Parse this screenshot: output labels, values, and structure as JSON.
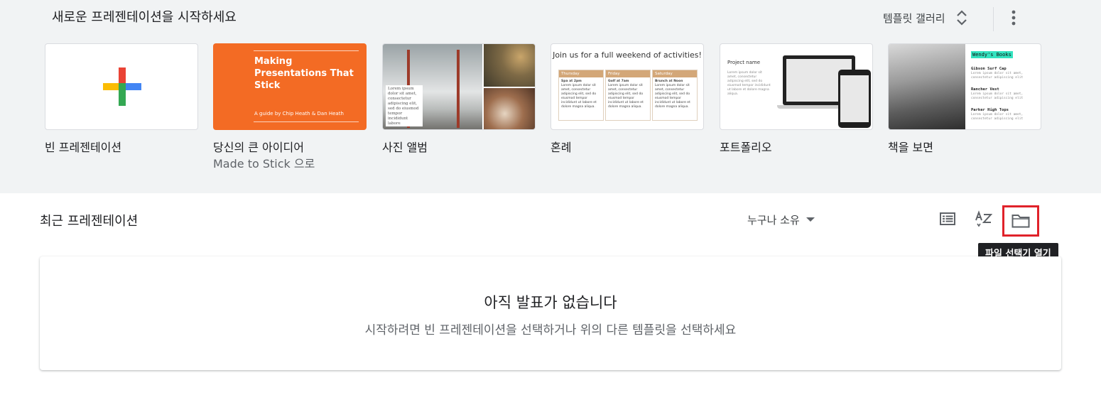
{
  "gallery": {
    "title": "새로운 프레젠테이션을 시작하세요",
    "template_gallery_label": "템플릿 갤러리",
    "templates": [
      {
        "label": "빈 프레젠테이션",
        "sublabel": ""
      },
      {
        "label": "당신의 큰 아이디어",
        "sublabel": "Made to Stick 으로"
      },
      {
        "label": "사진 앨범",
        "sublabel": ""
      },
      {
        "label": "혼례",
        "sublabel": ""
      },
      {
        "label": "포트폴리오",
        "sublabel": ""
      },
      {
        "label": "책을 보면",
        "sublabel": ""
      }
    ],
    "thumbs": {
      "made_to_stick_title": "Making Presentations That Stick",
      "made_to_stick_sub": "A guide by Chip Heath & Dan Heath",
      "photo_card_text": "Lorem ipsum dolor sit amet, consectetur adipiscing elit, sed do eiusmod tempor incididunt labore",
      "wedding_title": "Join us for a full weekend of activities!",
      "wedding_days": [
        "Thursday",
        "Friday",
        "Saturday"
      ],
      "wedding_events": [
        "Spa at 2pm",
        "Golf at 7am",
        "Brunch at Noon"
      ],
      "wedding_body": "Lorem ipsum dolor sit amet, consectetur adipiscing elit, sed do eiusmod tempor incididunt ut labore et dolore magna aliqua.",
      "portfolio_title": "Project name",
      "portfolio_body": "Lorem ipsum dolor sit amet, consectetur adipiscing elit, sed do eiusmod tempor incididunt ut labore et dolore magna aliqua.",
      "book_tag": "Wendy's Books",
      "book_entries": [
        "Gibson Surf Cap",
        "Rancher Vest",
        "Parker High Tops"
      ],
      "book_body": "Lorem ipsum dolor sit amet, consectetur adipiscing elit"
    }
  },
  "recent": {
    "title": "최근 프레젠테이션",
    "owner_filter": "누구나 소유",
    "tooltip": "파일 선택기 열기",
    "empty_title": "아직 발표가 없습니다",
    "empty_subtitle": "시작하려면 빈 프레젠테이션을 선택하거나 위의 다른 템플릿을 선택하세요"
  },
  "icons": {
    "unfold": "unfold-more-icon",
    "more": "more-vert-icon",
    "list_view": "list-view-icon",
    "sort": "sort-az-icon",
    "folder": "folder-icon",
    "plus": "google-plus-icon"
  },
  "colors": {
    "gallery_bg": "#f1f3f4",
    "highlight_red": "#e0222a",
    "orange_template": "#f36b24",
    "plus_red": "#ea4335",
    "plus_blue": "#4285f4",
    "plus_green": "#34a853",
    "plus_yellow": "#fbbc04"
  }
}
